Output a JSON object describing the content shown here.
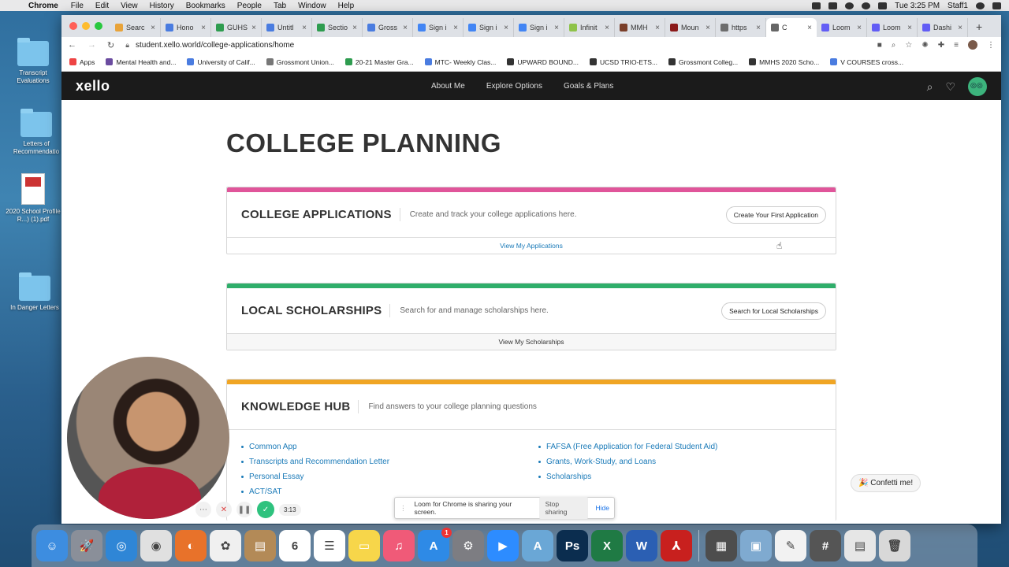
{
  "menubar": {
    "app": "Chrome",
    "menus": [
      "File",
      "Edit",
      "View",
      "History",
      "Bookmarks",
      "People",
      "Tab",
      "Window",
      "Help"
    ],
    "clock": "Tue 3:25 PM",
    "user": "Staff1"
  },
  "desktop": {
    "items": [
      {
        "label": "Transcript Evaluations",
        "kind": "folder"
      },
      {
        "label": "Letters of Recommendatio",
        "kind": "folder"
      },
      {
        "label": "2020 School Profile R...) (1).pdf",
        "kind": "pdf"
      },
      {
        "label": "In Danger Letters",
        "kind": "folder"
      }
    ]
  },
  "browser": {
    "tabs": [
      {
        "title": "Searc",
        "color": "#e8a33a"
      },
      {
        "title": "Hono",
        "color": "#4a7ce0"
      },
      {
        "title": "GUHS",
        "color": "#2e9c4f"
      },
      {
        "title": "Untitl",
        "color": "#4a7ce0"
      },
      {
        "title": "Sectio",
        "color": "#2e9c4f"
      },
      {
        "title": "Gross",
        "color": "#4a7ce0"
      },
      {
        "title": "Sign i",
        "color": "#4285f4"
      },
      {
        "title": "Sign i",
        "color": "#4285f4"
      },
      {
        "title": "Sign i",
        "color": "#4285f4"
      },
      {
        "title": "Infinit",
        "color": "#8fc34a"
      },
      {
        "title": "MMH",
        "color": "#7a3f2a"
      },
      {
        "title": "Moun",
        "color": "#8b1a1a"
      },
      {
        "title": "https",
        "color": "#6d6d6d"
      },
      {
        "title": "C",
        "color": "#666666"
      },
      {
        "title": "Loom",
        "color": "#625df5"
      },
      {
        "title": "Loom",
        "color": "#625df5"
      },
      {
        "title": "Dashi",
        "color": "#625df5"
      }
    ],
    "url": "student.xello.world/college-applications/home",
    "bookmarks": [
      {
        "label": "Apps",
        "color": "#e44"
      },
      {
        "label": "Mental Health and...",
        "color": "#6b4ca0"
      },
      {
        "label": "University of Calif...",
        "color": "#4a7ce0"
      },
      {
        "label": "Grossmont Union...",
        "color": "#777777"
      },
      {
        "label": "20-21 Master Gra...",
        "color": "#2e9c4f"
      },
      {
        "label": "MTC- Weekly Clas...",
        "color": "#4a7ce0"
      },
      {
        "label": "UPWARD BOUND...",
        "color": "#333333"
      },
      {
        "label": "UCSD TRIO-ETS...",
        "color": "#333333"
      },
      {
        "label": "Grossmont Colleg...",
        "color": "#333333"
      },
      {
        "label": "MMHS 2020 Scho...",
        "color": "#333333"
      },
      {
        "label": "V COURSES cross...",
        "color": "#4a7ce0"
      }
    ]
  },
  "xello": {
    "logo": "xello",
    "nav": [
      "About Me",
      "Explore Options",
      "Goals & Plans"
    ],
    "page_title": "COLLEGE PLANNING",
    "cards": {
      "applications": {
        "title": "COLLEGE APPLICATIONS",
        "desc": "Create and track your college applications here.",
        "button": "Create Your First Application",
        "footer": "View My Applications",
        "color": "#e0559a"
      },
      "scholarships": {
        "title": "LOCAL SCHOLARSHIPS",
        "desc": "Search for and manage scholarships here.",
        "button": "Search for Local Scholarships",
        "footer": "View My Scholarships",
        "color": "#2fae6a"
      },
      "knowledge": {
        "title": "KNOWLEDGE HUB",
        "desc": "Find answers to your college planning questions",
        "color": "#f0a524",
        "left_links": [
          "Common App",
          "Transcripts and Recommendation Letter",
          "Personal Essay",
          "ACT/SAT"
        ],
        "right_links": [
          "FAFSA (Free Application for Federal Student Aid)",
          "Grants, Work-Study, and Loans",
          "Scholarships"
        ]
      }
    },
    "confetti": "🎉 Confetti me!"
  },
  "loom": {
    "banner_text": "Loom for Chrome is sharing your screen.",
    "stop": "Stop sharing",
    "hide": "Hide",
    "timer": "3:13"
  },
  "dock": {
    "apps": [
      {
        "name": "finder",
        "color": "#3d8de0",
        "glyph": "☺"
      },
      {
        "name": "launchpad",
        "color": "#8a8f99",
        "glyph": "🚀"
      },
      {
        "name": "safari",
        "color": "#2f86d6",
        "glyph": "◎"
      },
      {
        "name": "chrome",
        "color": "#e0e0e0",
        "glyph": "◉"
      },
      {
        "name": "firefox",
        "color": "#e8722a",
        "glyph": "◐"
      },
      {
        "name": "photos",
        "color": "#f0f0f0",
        "glyph": "✿"
      },
      {
        "name": "contacts",
        "color": "#b38a57",
        "glyph": "▤"
      },
      {
        "name": "calendar",
        "color": "#ffffff",
        "glyph": "6"
      },
      {
        "name": "reminders",
        "color": "#ffffff",
        "glyph": "☰"
      },
      {
        "name": "notes",
        "color": "#f7d64a",
        "glyph": "▭"
      },
      {
        "name": "music",
        "color": "#f05a78",
        "glyph": "♫"
      },
      {
        "name": "app-store",
        "color": "#2e8ae6",
        "glyph": "A",
        "badge": "1"
      },
      {
        "name": "system-preferences",
        "color": "#7d7d82",
        "glyph": "⚙"
      },
      {
        "name": "zoom",
        "color": "#2d8cff",
        "glyph": "▶"
      },
      {
        "name": "archive",
        "color": "#6aa7d6",
        "glyph": "A"
      },
      {
        "name": "photoshop",
        "color": "#0b2d4f",
        "glyph": "Ps"
      },
      {
        "name": "excel",
        "color": "#1f7a44",
        "glyph": "X"
      },
      {
        "name": "word",
        "color": "#2b5fb3",
        "glyph": "W"
      },
      {
        "name": "acrobat",
        "color": "#c8201e",
        "glyph": "⅄"
      },
      {
        "name": "calculator",
        "color": "#4d4d4d",
        "glyph": "▦"
      },
      {
        "name": "preview",
        "color": "#7faad0",
        "glyph": "▣"
      },
      {
        "name": "textedit",
        "color": "#f2f2f2",
        "glyph": "✎"
      },
      {
        "name": "calculator-2",
        "color": "#555555",
        "glyph": "#"
      },
      {
        "name": "downloads",
        "color": "#e6e6e6",
        "glyph": "▤"
      },
      {
        "name": "trash",
        "color": "#d8d8d8",
        "glyph": "🗑"
      }
    ]
  }
}
